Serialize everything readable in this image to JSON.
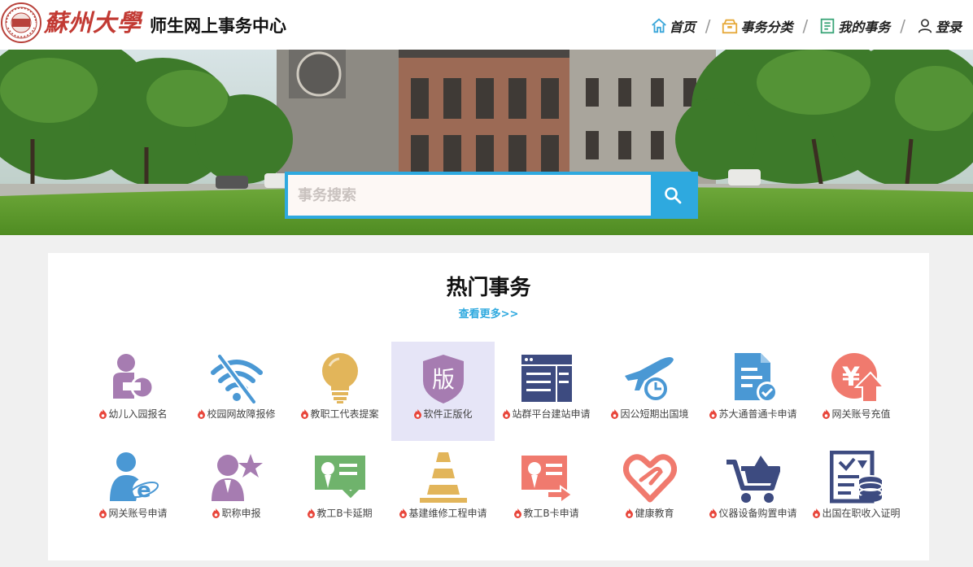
{
  "header": {
    "site_title": "师生网上事务中心",
    "logo_text": "蘇州大學",
    "nav": [
      {
        "label": "首页",
        "icon": "home-icon"
      },
      {
        "label": "事务分类",
        "icon": "box-icon"
      },
      {
        "label": "我的事务",
        "icon": "document-icon"
      },
      {
        "label": "登录",
        "icon": "user-icon"
      }
    ]
  },
  "search": {
    "placeholder": "事务搜索",
    "icon": "search-icon"
  },
  "hot": {
    "title": "热门事务",
    "more": "查看更多>>",
    "items": [
      {
        "label": "幼儿入园报名",
        "icon": "child-enroll-icon",
        "color": "#a67cb1"
      },
      {
        "label": "校园网故障报修",
        "icon": "wifi-off-icon",
        "color": "#4a98d4"
      },
      {
        "label": "教职工代表提案",
        "icon": "lightbulb-icon",
        "color": "#e2b55a"
      },
      {
        "label": "软件正版化",
        "icon": "shield-icon",
        "color": "#a67cb1",
        "badge": "版"
      },
      {
        "label": "站群平台建站申请",
        "icon": "web-layout-icon",
        "color": "#3d4b80"
      },
      {
        "label": "因公短期出国境",
        "icon": "airplane-icon",
        "color": "#4a98d4"
      },
      {
        "label": "苏大通普通卡申请",
        "icon": "card-check-icon",
        "color": "#4a98d4"
      },
      {
        "label": "网关账号充值",
        "icon": "yuan-icon",
        "color": "#f07a6e"
      },
      {
        "label": "网关账号申请",
        "icon": "user-ie-icon",
        "color": "#4a98d4"
      },
      {
        "label": "职称申报",
        "icon": "user-star-icon",
        "color": "#a67cb1"
      },
      {
        "label": "教工B卡延期",
        "icon": "id-card-check-icon",
        "color": "#6fb36c"
      },
      {
        "label": "基建维修工程申请",
        "icon": "traffic-cone-icon",
        "color": "#e2b55a"
      },
      {
        "label": "教工B卡申请",
        "icon": "id-card-arrow-icon",
        "color": "#f07a6e"
      },
      {
        "label": "健康教育",
        "icon": "heart-hand-icon",
        "color": "#f07a6e"
      },
      {
        "label": "仪器设备购置申请",
        "icon": "cart-icon",
        "color": "#3d4b80"
      },
      {
        "label": "出国在职收入证明",
        "icon": "document-coins-icon",
        "color": "#3d4b80"
      }
    ]
  },
  "colors": {
    "accent": "#2ea9df",
    "hot": "#e8463b",
    "active_tile": "#e6e5f7"
  }
}
